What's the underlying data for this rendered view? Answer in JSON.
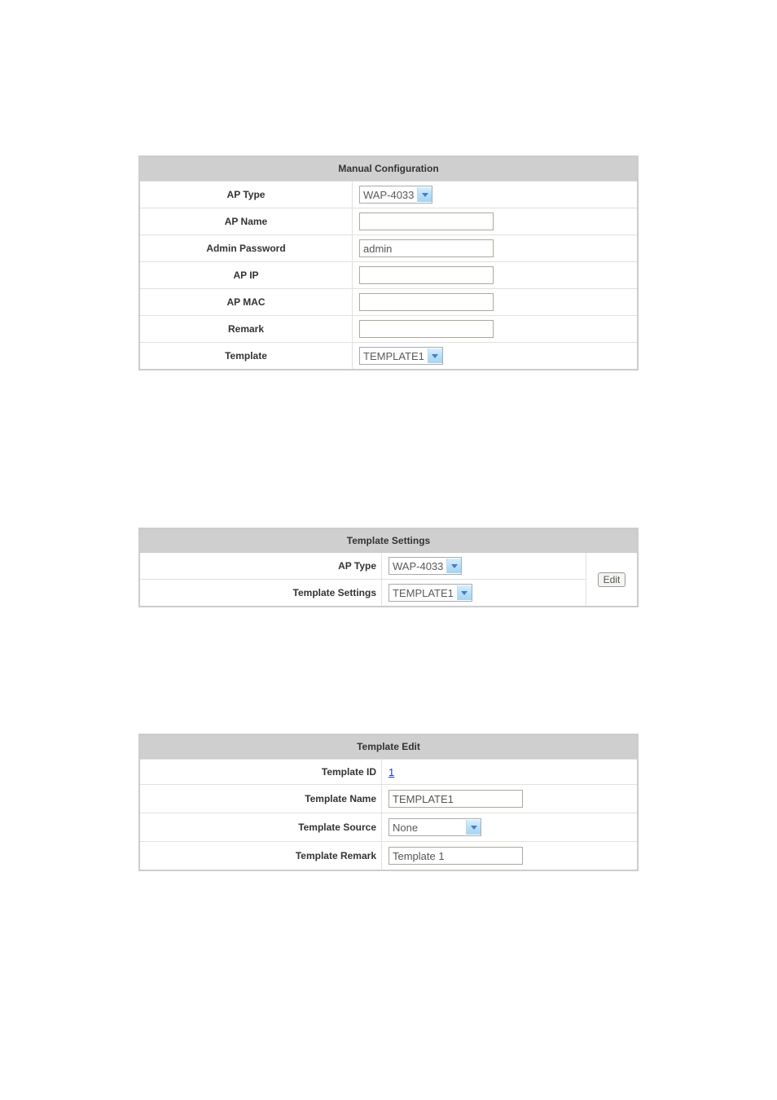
{
  "manual_config": {
    "title": "Manual Configuration",
    "rows": {
      "ap_type": {
        "label": "AP Type",
        "value": "WAP-4033"
      },
      "ap_name": {
        "label": "AP Name",
        "value": ""
      },
      "admin_password": {
        "label": "Admin Password",
        "value": "admin"
      },
      "ap_ip": {
        "label": "AP IP",
        "value": ""
      },
      "ap_mac": {
        "label": "AP MAC",
        "value": ""
      },
      "remark": {
        "label": "Remark",
        "value": ""
      },
      "template": {
        "label": "Template",
        "value": "TEMPLATE1"
      }
    }
  },
  "template_settings": {
    "title": "Template Settings",
    "rows": {
      "ap_type": {
        "label": "AP Type",
        "value": "WAP-4033"
      },
      "template_settings": {
        "label": "Template Settings",
        "value": "TEMPLATE1"
      }
    },
    "edit_label": "Edit"
  },
  "template_edit": {
    "title": "Template Edit",
    "rows": {
      "template_id": {
        "label": "Template ID",
        "value": "1"
      },
      "template_name": {
        "label": "Template Name",
        "value": "TEMPLATE1"
      },
      "template_source": {
        "label": "Template Source",
        "value": "None"
      },
      "template_remark": {
        "label": "Template Remark",
        "value": "Template 1"
      }
    }
  }
}
